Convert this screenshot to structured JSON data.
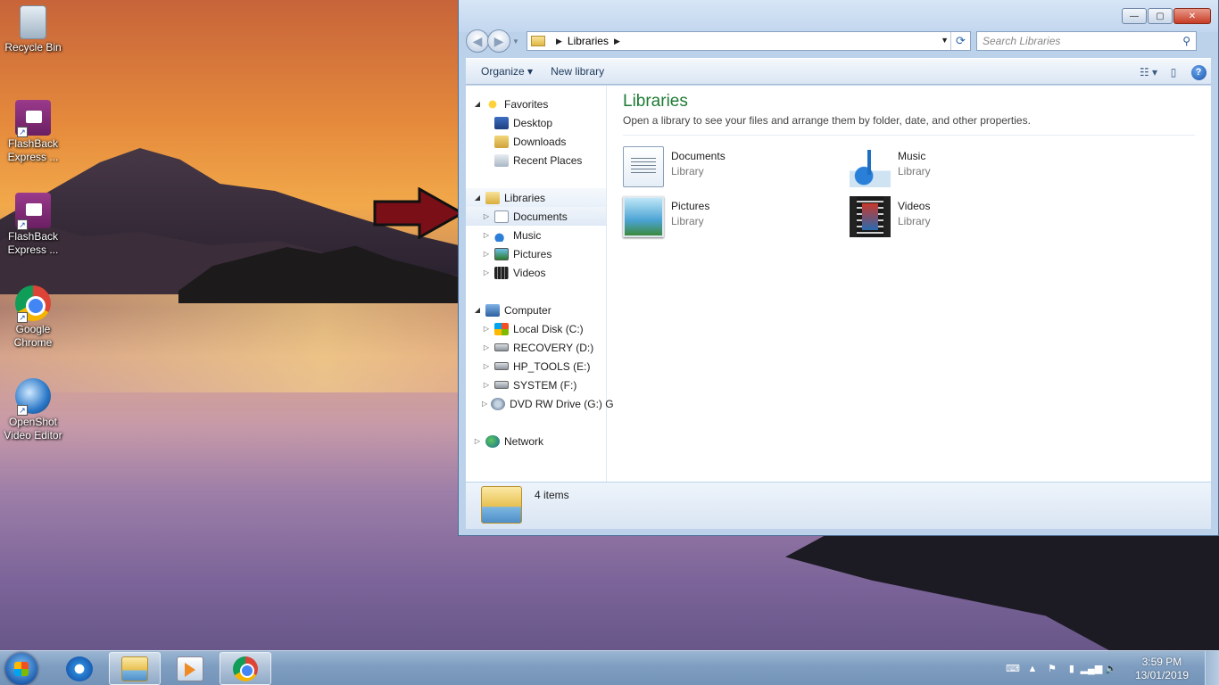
{
  "desktop": {
    "icons": [
      {
        "label": "Recycle Bin"
      },
      {
        "label": "FlashBack Express ..."
      },
      {
        "label": "FlashBack Express ..."
      },
      {
        "label": "Google Chrome"
      },
      {
        "label": "OpenShot Video Editor"
      }
    ]
  },
  "window": {
    "controls": {
      "minimize": "—",
      "maximize": "▢",
      "close": "✕"
    },
    "address": {
      "segment": "Libraries"
    },
    "search": {
      "placeholder": "Search Libraries"
    },
    "toolbar": {
      "organize": "Organize",
      "new_library": "New library"
    },
    "nav": {
      "favorites": "Favorites",
      "desktop": "Desktop",
      "downloads": "Downloads",
      "recent": "Recent Places",
      "libraries": "Libraries",
      "documents": "Documents",
      "music": "Music",
      "pictures": "Pictures",
      "videos": "Videos",
      "computer": "Computer",
      "local_disk": "Local Disk (C:)",
      "recovery": "RECOVERY (D:)",
      "hp_tools": "HP_TOOLS (E:)",
      "system": "SYSTEM (F:)",
      "dvd": "DVD RW Drive (G:) G",
      "network": "Network"
    },
    "main": {
      "title": "Libraries",
      "subtitle": "Open a library to see your files and arrange them by folder, date, and other properties.",
      "items": [
        {
          "name": "Documents",
          "type": "Library",
          "icon": "documents-library-icon"
        },
        {
          "name": "Music",
          "type": "Library",
          "icon": "music-library-icon"
        },
        {
          "name": "Pictures",
          "type": "Library",
          "icon": "pictures-library-icon"
        },
        {
          "name": "Videos",
          "type": "Library",
          "icon": "videos-library-icon"
        }
      ]
    },
    "status": {
      "count": "4 items"
    }
  },
  "taskbar": {
    "time": "3:59 PM",
    "date": "13/01/2019"
  },
  "colors": {
    "title_green": "#1e7b34",
    "arrow": "#7a0f17"
  }
}
